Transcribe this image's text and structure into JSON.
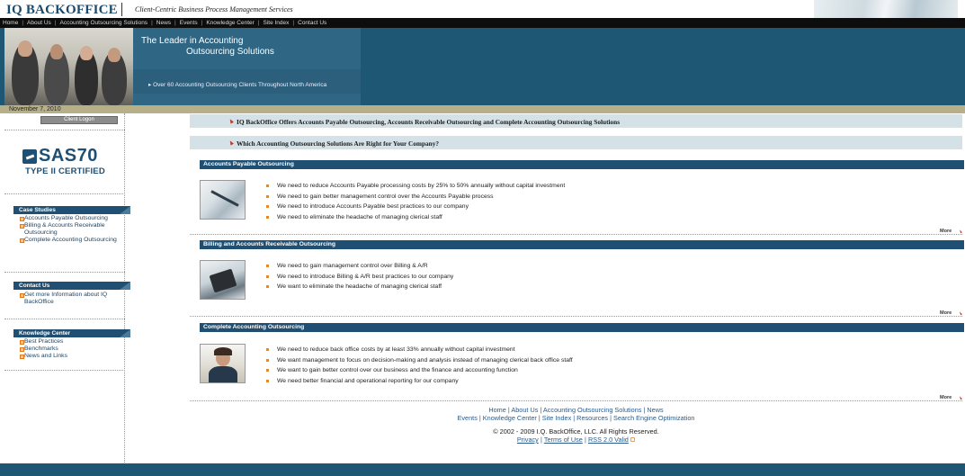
{
  "header": {
    "logo": "IQ BACKOFFICE",
    "tagline": "Client-Centric Business Process Management Services"
  },
  "topnav": [
    "Home",
    "About Us",
    "Accounting Outsourcing Solutions",
    "News",
    "Events",
    "Knowledge Center",
    "Site Index",
    "Contact Us"
  ],
  "banner": {
    "title_line1": "The Leader in Accounting",
    "title_line2": "Outsourcing Solutions",
    "subtitle": "▸ Over 60 Accounting Outsourcing Clients Throughout North America"
  },
  "date": "November 7, 2010",
  "sidebar": {
    "logon_label": "Client Logon",
    "sas_main": "SAS70",
    "sas_sub": "TYPE II CERTIFIED",
    "case_studies": {
      "heading": "Case Studies",
      "items": [
        "Accounts Payable Outsourcing",
        "Billing & Accounts Receivable Outsourcing",
        "Complete Accounting Outsourcing"
      ]
    },
    "contact": {
      "heading": "Contact Us",
      "items": [
        "Get more Information about IQ BackOffice"
      ]
    },
    "knowledge": {
      "heading": "Knowledge Center",
      "items": [
        "Best Practices",
        "Benchmarks",
        "News and Links"
      ]
    }
  },
  "features": [
    "IQ BackOffice Offers Accounts Payable Outsourcing, Accounts Receivable Outsourcing and Complete Accounting Outsourcing Solutions",
    "Which Accounting Outsourcing Solutions Are Right for Your Company?"
  ],
  "sections": [
    {
      "title": "Accounts Payable Outsourcing",
      "bullets": [
        "We need to reduce Accounts Payable processing costs by 25% to 50% annually without capital investment",
        "We need to gain better management control over the Accounts Payable process",
        "We need to introduce Accounts Payable best practices to our company",
        "We need to eliminate the headache of managing clerical staff"
      ],
      "more": "More"
    },
    {
      "title": "Billing and Accounts Receivable Outsourcing",
      "bullets": [
        "We need to gain management control over Billing & A/R",
        "We need to introduce Billing & A/R best practices to our company",
        "We want to eliminate the headache of managing clerical staff"
      ],
      "more": "More"
    },
    {
      "title": "Complete Accounting Outsourcing",
      "bullets": [
        "We need to reduce back office costs by at least 33% annually without capital investment",
        "We want management to focus on decision-making and analysis instead of managing clerical back office staff",
        "We want to gain better control over our business and the finance and accounting function",
        "We need better financial and operational reporting for our company"
      ],
      "more": "More"
    }
  ],
  "footer": {
    "line1": "Home | About Us | Accounting Outsourcing Solutions | News",
    "line2": "Events | Knowledge Center | Site Index | Resources | Search Engine Optimization",
    "copyright": "© 2002 - 2009 I.Q. BackOffice, LLC. All Rights Reserved.",
    "privacy": "Privacy",
    "terms": "Terms of Use",
    "rss": "RSS 2.0 Valid"
  }
}
